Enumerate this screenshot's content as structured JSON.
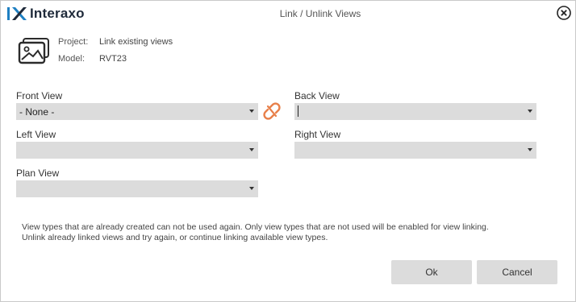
{
  "brand": {
    "name": "Interaxo"
  },
  "window": {
    "title": "Link / Unlink Views"
  },
  "info": {
    "project_label": "Project:",
    "project_value": "Link existing views",
    "model_label": "Model:",
    "model_value": "RVT23"
  },
  "fields": {
    "front": {
      "label": "Front View",
      "value": "- None -"
    },
    "back": {
      "label": "Back View",
      "value": ""
    },
    "left": {
      "label": "Left View",
      "value": ""
    },
    "right": {
      "label": "Right View",
      "value": ""
    },
    "plan": {
      "label": "Plan View",
      "value": ""
    }
  },
  "note": {
    "line1": "View types that are already created can not be used again. Only view types that are not used  will be enabled for view linking.",
    "line2": "Unlink already linked views and try again, or continue linking available view types."
  },
  "buttons": {
    "ok": "Ok",
    "cancel": "Cancel"
  },
  "icons": {
    "logo": "interaxo-logo-icon",
    "close": "close-icon",
    "project": "image-gallery-icon",
    "link": "broken-link-icon"
  },
  "colors": {
    "accent": "#e8804a",
    "select_bg": "#dcdcdc",
    "button_bg": "#dcdcdc",
    "logo_blue": "#1e7fc2"
  }
}
